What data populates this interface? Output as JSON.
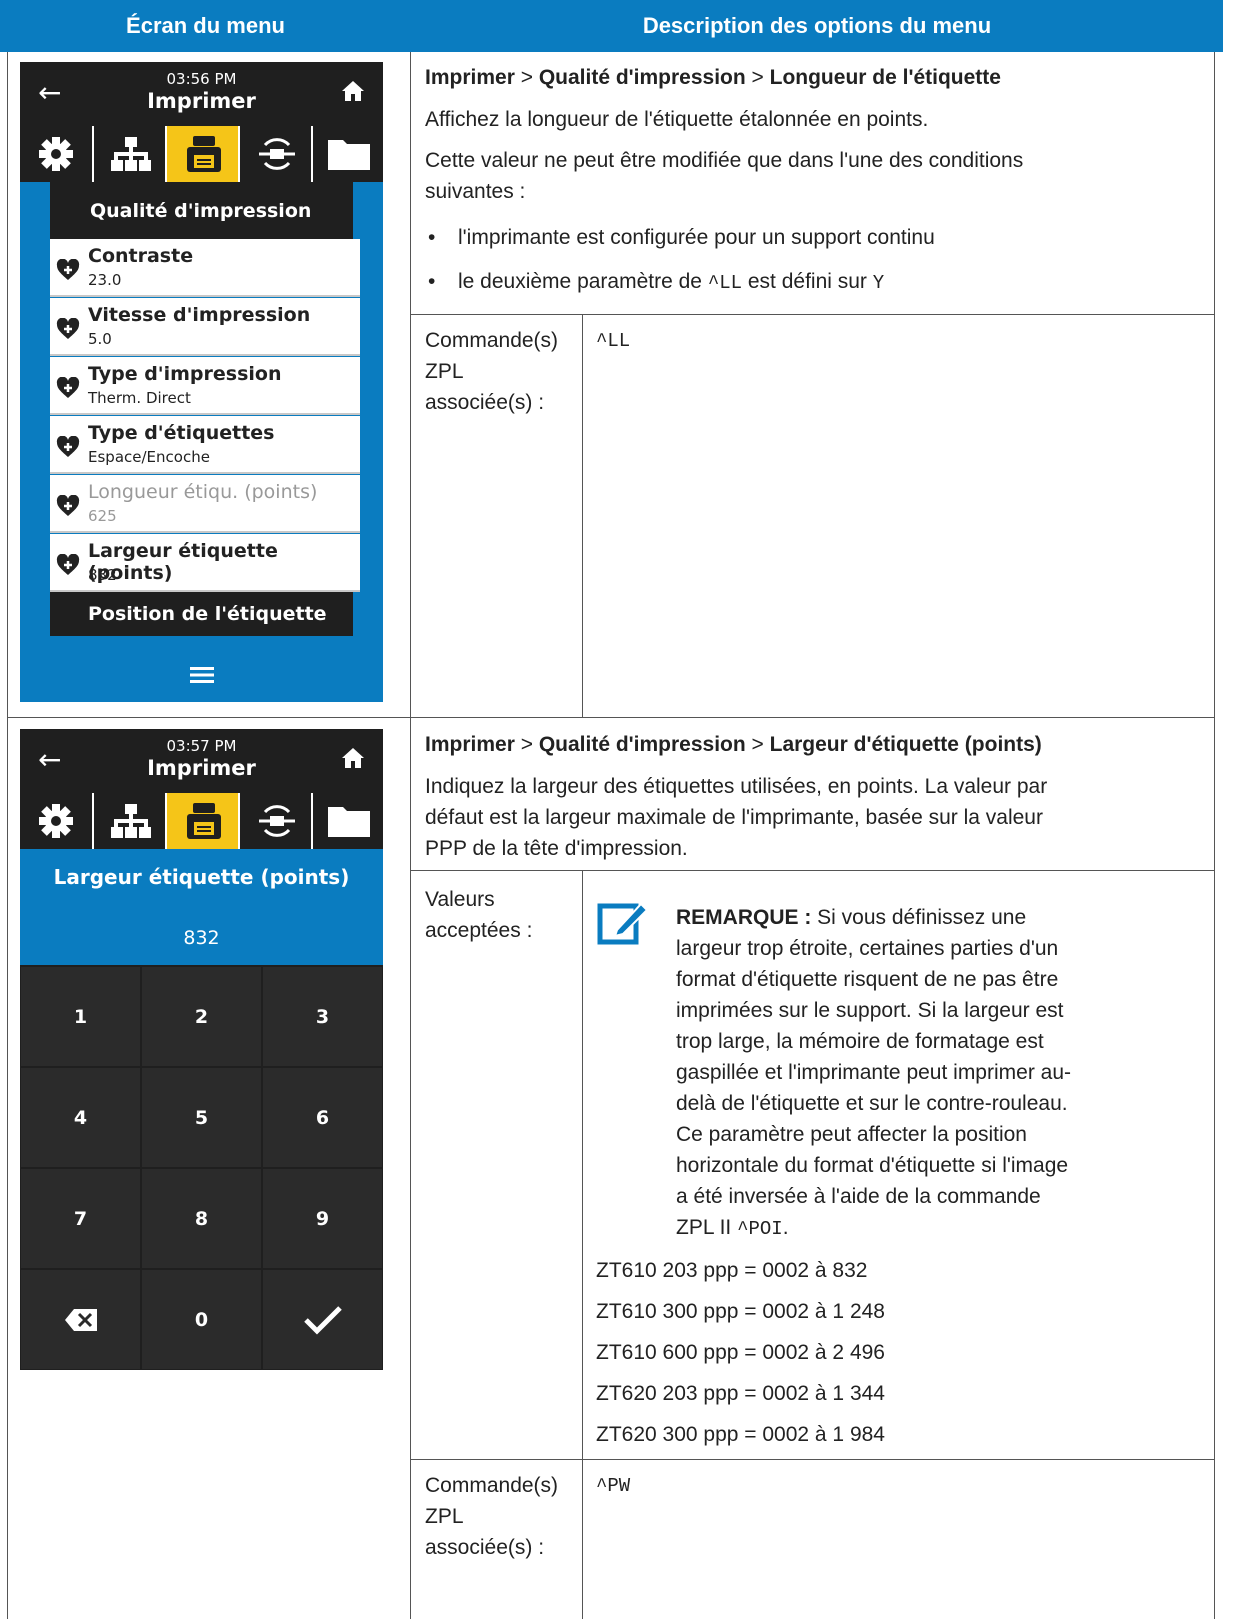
{
  "table": {
    "col1_header": "Écran du menu",
    "col2_header": "Description des options du menu"
  },
  "row1": {
    "screen": {
      "time": "03:56 PM",
      "title": "Imprimer",
      "section": "Qualité d'impression",
      "items": [
        {
          "label": "Contraste",
          "value": "23.0"
        },
        {
          "label": "Vitesse d'impression",
          "value": "5.0"
        },
        {
          "label": "Type d'impression",
          "value": "Therm. Direct"
        },
        {
          "label": "Type d'étiquettes",
          "value": "Espace/Encoche"
        },
        {
          "label": "Longueur étiqu. (points)",
          "value": "625"
        },
        {
          "label": "Largeur étiquette (points)",
          "value": "832"
        }
      ],
      "next_section": "Position de l'étiquette",
      "menu_icon": "hamburger-icon"
    },
    "breadcrumb": {
      "a": "Imprimer",
      "sep": " > ",
      "b": "Qualité d'impression",
      "c": "Longueur de l'étiquette"
    },
    "p1": "Affichez la longueur de l'étiquette étalonnée en points.",
    "p2a": "Cette valeur ne peut être modifiée que dans l'une des conditions",
    "p2b": "suivantes :",
    "bullet1": "l'imprimante est configurée pour un support continu",
    "bullet2_pre": "le deuxième paramètre de ",
    "bullet2_code": "^LL",
    "bullet2_mid": " est défini sur ",
    "bullet2_code2": "Y",
    "cmd_label": [
      "Commande(s)",
      "ZPL",
      "associée(s) :"
    ],
    "cmd_value": "^LL"
  },
  "row2": {
    "screen": {
      "time": "03:57 PM",
      "title": "Imprimer",
      "field_label": "Largeur étiquette (points)",
      "field_value": "832",
      "keys": [
        "1",
        "2",
        "3",
        "4",
        "5",
        "6",
        "7",
        "8",
        "9",
        "",
        "0",
        ""
      ]
    },
    "breadcrumb": {
      "a": "Imprimer",
      "sep": " > ",
      "b": "Qualité d'impression",
      "c": "Largeur d'étiquette (points)"
    },
    "p1": [
      "Indiquez la largeur des étiquettes utilisées, en points. La valeur par",
      "défaut est la largeur maximale de l'imprimante, basée sur la valeur",
      "PPP de la tête d'impression."
    ],
    "values_label": [
      "Valeurs",
      "acceptées :"
    ],
    "note_title": "REMARQUE :",
    "note_lines": [
      " Si vous définissez une",
      "largeur trop étroite, certaines parties d'un",
      "format d'étiquette risquent de ne pas être",
      "imprimées sur le support. Si la largeur est",
      "trop large, la mémoire de formatage est",
      "gaspillée et l'imprimante peut imprimer au-",
      "delà de l'étiquette et sur le contre-rouleau.",
      "Ce paramètre peut affecter la position",
      "horizontale du format d'étiquette si l'image",
      "a été inversée à l'aide de la commande"
    ],
    "note_last_pre": "ZPL II ",
    "note_last_code": "^POI",
    "note_last_post": ".",
    "values": [
      "ZT610 203 ppp = 0002 à 832",
      "ZT610 300 ppp = 0002 à 1 248",
      "ZT610 600 ppp = 0002 à 2 496",
      "ZT620 203 ppp = 0002 à 1 344",
      "ZT620 300 ppp = 0002 à 1 984"
    ],
    "cmd_label": [
      "Commande(s)",
      "ZPL",
      "associée(s) :"
    ],
    "cmd_value": "^PW"
  },
  "colors": {
    "header_blue": "#0a7cc0",
    "screen_blue": "#0a7cc0",
    "active_tab": "#f5c518",
    "dark": "#1f1f1f"
  }
}
